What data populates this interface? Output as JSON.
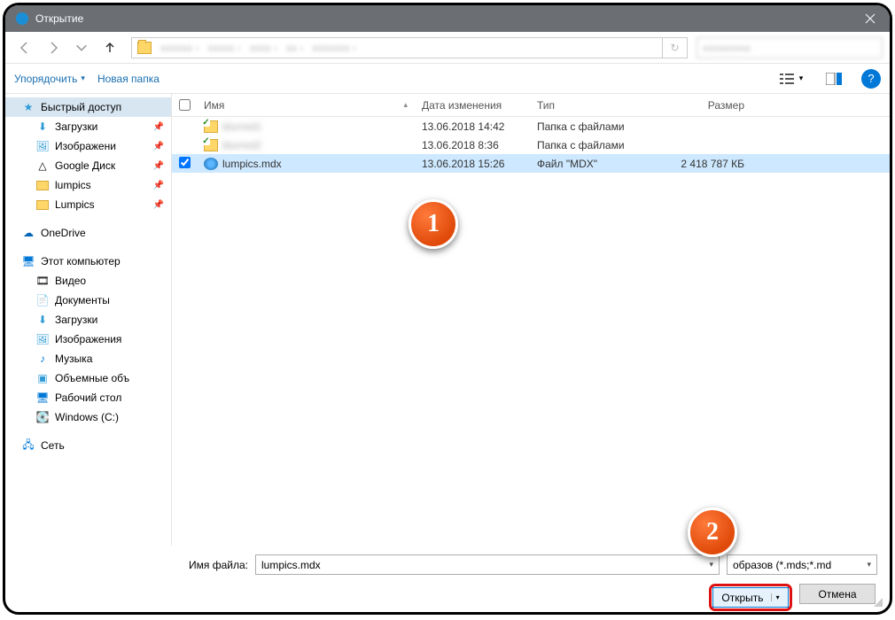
{
  "titlebar": {
    "title": "Открытие"
  },
  "toolbar": {
    "organize": "Упорядочить",
    "new_folder": "Новая папка",
    "help": "?"
  },
  "sidebar": {
    "quick": "Быстрый доступ",
    "downloads": "Загрузки",
    "pictures": "Изображени",
    "gdrive": "Google Диск",
    "lumpics": "lumpics",
    "lumpics2": "Lumpics",
    "onedrive": "OneDrive",
    "thispc": "Этот компьютер",
    "video": "Видео",
    "documents": "Документы",
    "downloads2": "Загрузки",
    "pictures2": "Изображения",
    "music": "Музыка",
    "volumes": "Объемные объ",
    "desktop": "Рабочий стол",
    "cdrive": "Windows (C:)",
    "network": "Сеть"
  },
  "columns": {
    "name": "Имя",
    "date": "Дата изменения",
    "type": "Тип",
    "size": "Размер"
  },
  "rows": [
    {
      "name": "blurred1",
      "date": "13.06.2018 14:42",
      "type": "Папка с файлами",
      "size": "",
      "kind": "folder",
      "blurred": true
    },
    {
      "name": "blurred2",
      "date": "13.06.2018 8:36",
      "type": "Папка с файлами",
      "size": "",
      "kind": "folder",
      "blurred": true
    },
    {
      "name": "lumpics.mdx",
      "date": "13.06.2018 15:26",
      "type": "Файл \"MDX\"",
      "size": "2 418 787 КБ",
      "kind": "mdx",
      "selected": true
    }
  ],
  "footer": {
    "filename_label": "Имя файла:",
    "filename_value": "lumpics.mdx",
    "filter": "образов (*.mds;*.md",
    "open": "Открыть",
    "cancel": "Отмена"
  },
  "callouts": {
    "one": "1",
    "two": "2"
  }
}
